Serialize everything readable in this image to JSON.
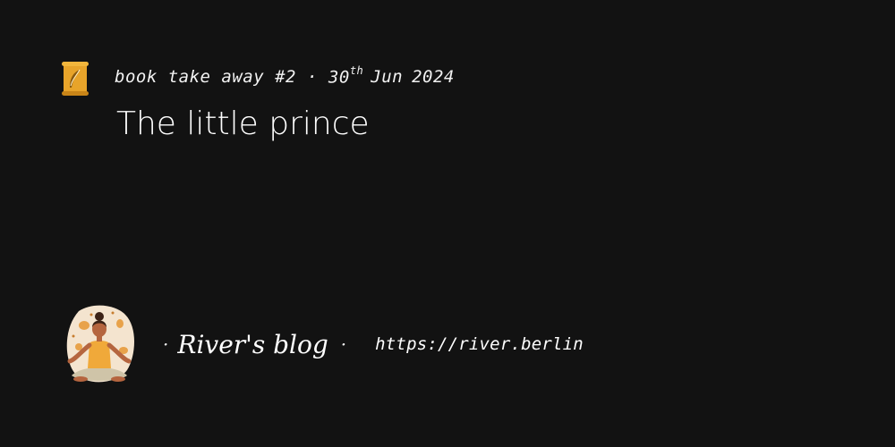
{
  "header": {
    "category": "book take away #2",
    "separator": "·",
    "day": "30",
    "day_suffix": "th",
    "month": "Jun",
    "year": "2024"
  },
  "post": {
    "title": "The little prince"
  },
  "footer": {
    "bullet": "·",
    "blog_name": "River's blog",
    "separator": "·",
    "url": "https://river.berlin"
  },
  "icons": {
    "post_icon": "scroll-quill-icon",
    "avatar": "meditating-person-avatar"
  },
  "colors": {
    "background": "#121212",
    "text": "#ffffff",
    "scroll_gold": "#e8a42a"
  }
}
